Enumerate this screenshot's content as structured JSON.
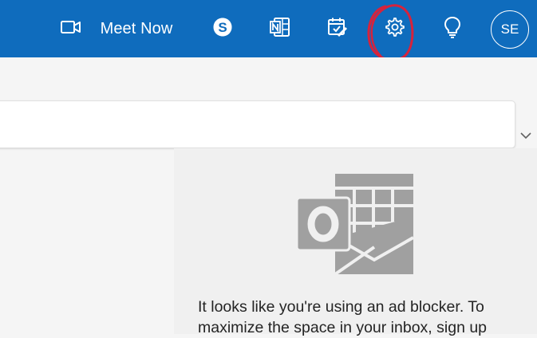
{
  "topbar": {
    "meet_now": {
      "label": "Meet Now",
      "icon": "video-camera-icon"
    },
    "skype": {
      "icon": "skype-icon"
    },
    "onenote": {
      "icon": "onenote-icon"
    },
    "todo": {
      "icon": "calendar-check-icon"
    },
    "settings": {
      "icon": "gear-icon"
    },
    "tips": {
      "icon": "lightbulb-icon"
    },
    "avatar": {
      "initials": "SE"
    }
  },
  "reading_pane": {
    "logo": "outlook-logo",
    "message": "It looks like you're using an ad blocker. To maximize the space in your inbox, sign up"
  },
  "colors": {
    "brand": "#0f6cbd",
    "annotation": "#d6233c",
    "logo_gray": "#a0a0a0"
  }
}
